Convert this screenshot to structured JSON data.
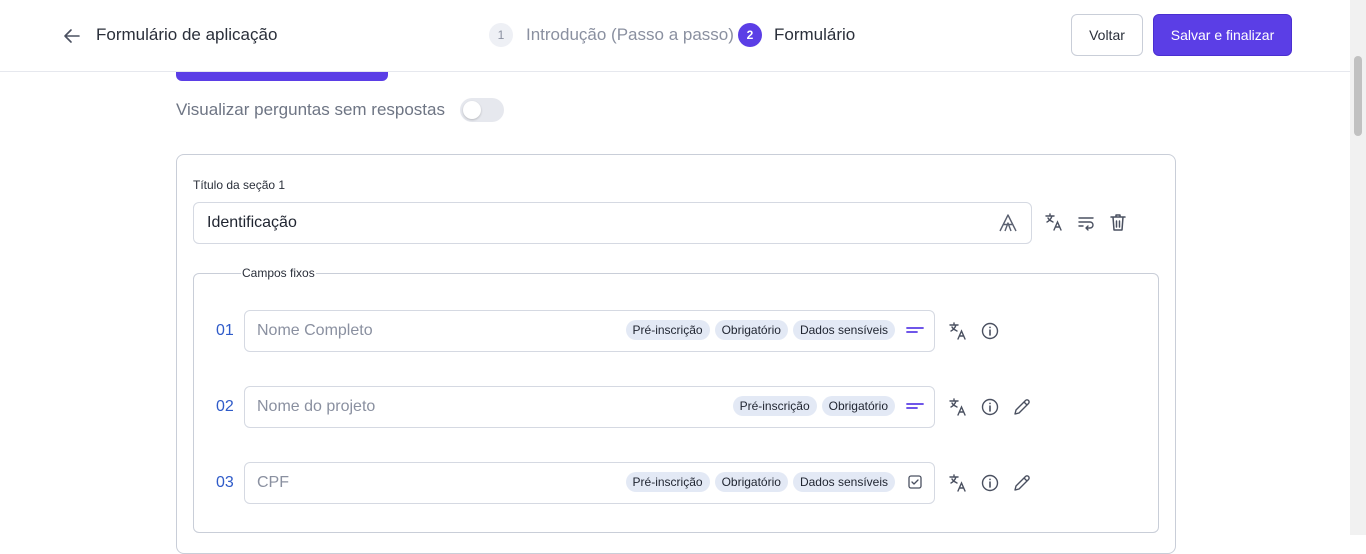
{
  "header": {
    "back_icon": "arrow-left-icon",
    "title": "Formulário de aplicação",
    "steps": [
      {
        "number": "1",
        "label": "Introdução (Passo a passo)"
      },
      {
        "number": "2",
        "label": "Formulário"
      }
    ],
    "back_button": "Voltar",
    "save_button": "Salvar e finalizar"
  },
  "toggle": {
    "label": "Visualizar perguntas sem respostas",
    "checked": false
  },
  "section": {
    "label": "Título da seção 1",
    "value": "Identificação",
    "fixed_fields_legend": "Campos fixos",
    "fields": [
      {
        "num": "01",
        "placeholder": "Nome Completo",
        "tags": [
          "Pré-inscrição",
          "Obrigatório",
          "Dados sensíveis"
        ],
        "type_icon": "short-text-icon",
        "editable": false
      },
      {
        "num": "02",
        "placeholder": "Nome do projeto",
        "tags": [
          "Pré-inscrição",
          "Obrigatório"
        ],
        "type_icon": "short-text-icon",
        "editable": true
      },
      {
        "num": "03",
        "placeholder": "CPF",
        "tags": [
          "Pré-inscrição",
          "Obrigatório",
          "Dados sensíveis"
        ],
        "type_icon": "checkbox-icon",
        "editable": true
      }
    ]
  },
  "colors": {
    "primary": "#5b3ee6",
    "field_number": "#2f5bc9",
    "tag_bg": "#e3e9f5"
  }
}
